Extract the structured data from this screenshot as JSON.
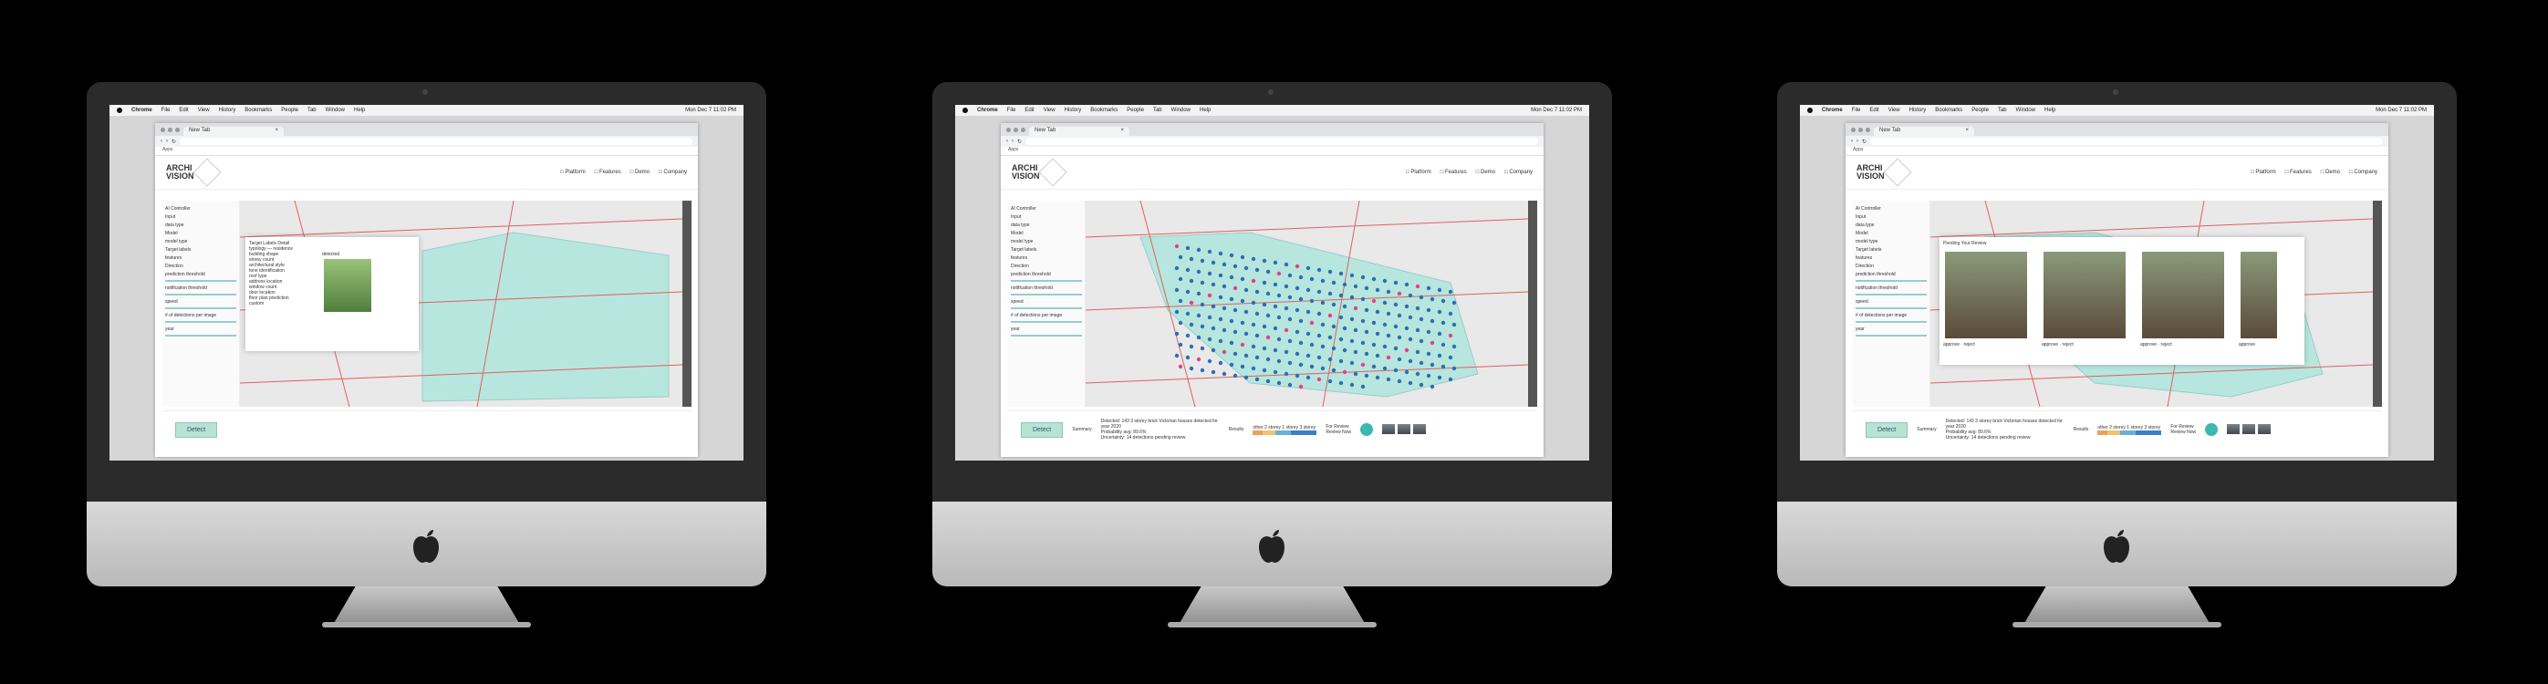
{
  "menubar": {
    "app": "Chrome",
    "items": [
      "File",
      "Edit",
      "View",
      "History",
      "Bookmarks",
      "People",
      "Tab",
      "Window",
      "Help"
    ],
    "clock": "Mon Dec 7 11:02 PM"
  },
  "browser": {
    "tab_title": "New Tab",
    "bookmarks_label": "Apps"
  },
  "site": {
    "logo_line1": "ARCHI",
    "logo_line2": "VISION",
    "nav": [
      "Platform",
      "Features",
      "Demo",
      "Company"
    ]
  },
  "sidebar": {
    "title": "AI Controller",
    "input_label": "Input",
    "data_type": "data type",
    "data_source": "data source",
    "model_label": "Model",
    "model_type": "model type",
    "model_value": "detect",
    "target_label": "Target labels",
    "features": "features",
    "features_value": "detect",
    "direction_label": "Direction",
    "prediction_threshold": "prediction threshold",
    "notification_threshold": "notification threshold",
    "speed": "speed",
    "detections_per_image": "# of detections per image",
    "year": "year"
  },
  "detect_button": "Detect",
  "screen1_popup": {
    "title": "Target Labels Detail",
    "typology_label": "typology",
    "typology_value": "residence",
    "options": [
      "building shape",
      "storey count",
      "architectural style",
      "tone identification",
      "roof type",
      "address location",
      "window count",
      "door location",
      "floor plan prediction"
    ],
    "custom_label": "custom",
    "image_tag": "detected"
  },
  "summary": {
    "label": "Summary",
    "detected_label": "Detected:",
    "detected_value": "143 3 storey brick Victorian houses detected for year 2020",
    "probability_label": "Probability avg:",
    "probability_value": "89.6%",
    "uncertainty_label": "Uncertainty:",
    "uncertainty_value": "14 detections pending review",
    "results_label": "Results",
    "results_legend": "other 2 storey 1 storey 3 storey",
    "review_label": "For Review",
    "review_button": "Review Now"
  },
  "screen3_popup": {
    "title": "Pending Your Review",
    "approve": "approve",
    "reject": "reject"
  },
  "colors": {
    "accent": "#3bb8b0",
    "map_region": "#b7e6de",
    "dot_blue": "#2a6fb5",
    "dot_pink": "#e83e8c",
    "road_red": "#e06060"
  },
  "results_bar": [
    {
      "color": "#e9a25b",
      "share": 0.15
    },
    {
      "color": "#f1c36b",
      "share": 0.2
    },
    {
      "color": "#6bb0d6",
      "share": 0.25
    },
    {
      "color": "#3d7fc4",
      "share": 0.4
    }
  ]
}
